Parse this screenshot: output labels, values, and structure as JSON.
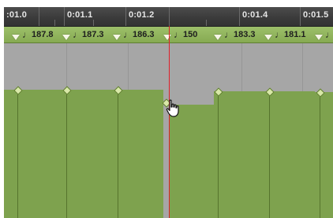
{
  "ruler": {
    "times": [
      ":01.0",
      "0:01.1",
      "0:01.2",
      "0:01.4",
      "0:01.5"
    ]
  },
  "tempo": {
    "markers": [
      {
        "bpm": "187.8"
      },
      {
        "bpm": "187.3"
      },
      {
        "bpm": "186.3"
      },
      {
        "bpm": "150"
      },
      {
        "bpm": "183.3"
      },
      {
        "bpm": "181.1"
      },
      {
        "bpm": ""
      }
    ]
  },
  "colors": {
    "playhead": "#e0202a",
    "tempo_fill": "#7ea24e",
    "track_bg": "#a6a6a6",
    "ruler_bg": "#3a3a3a"
  },
  "icons": {
    "note": "quarter-note-icon",
    "marker": "tempo-marker-triangle-icon",
    "cursor": "hand-pointer-icon"
  }
}
